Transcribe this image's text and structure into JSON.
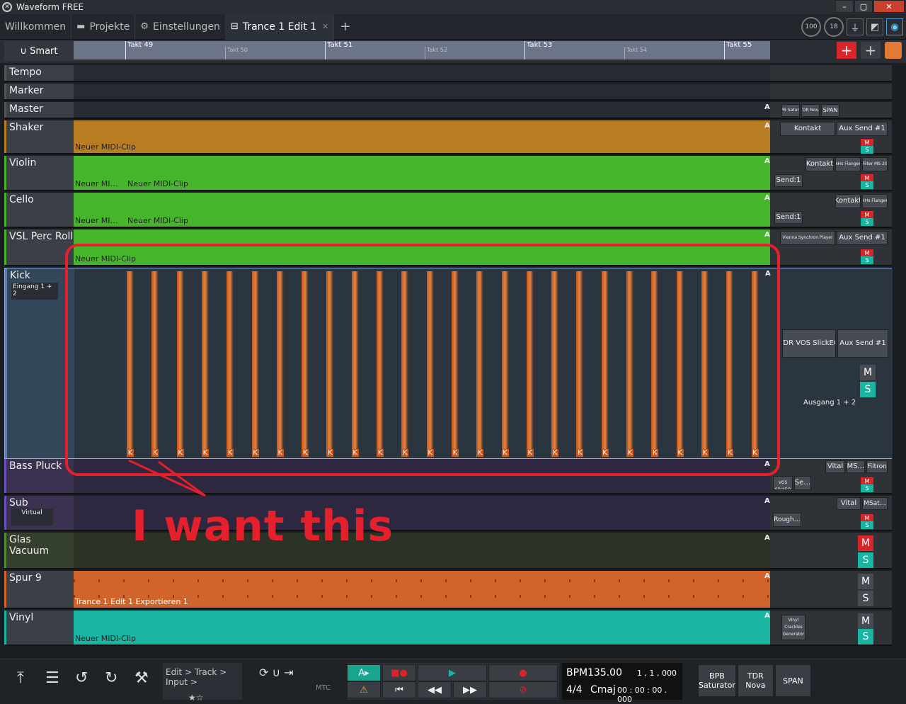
{
  "app": {
    "title": "Waveform FREE"
  },
  "window_buttons": [
    "–",
    "▢",
    "✕"
  ],
  "tabs": [
    {
      "label": "Willkommen",
      "icon": ""
    },
    {
      "label": "Projekte",
      "icon": "folder-icon"
    },
    {
      "label": "Einstellungen",
      "icon": "gear-icon"
    },
    {
      "label": "Trance 1 Edit 1",
      "icon": "edit-icon",
      "active": true
    }
  ],
  "top_right": {
    "cpu": "100",
    "latency": "18"
  },
  "smart": "Smart",
  "ruler": {
    "major": [
      "Takt 49",
      "Takt 51",
      "Takt 53",
      "Takt 55"
    ],
    "minor": [
      "Takt 50",
      "Takt 52",
      "Takt 54"
    ]
  },
  "tracks": [
    {
      "name": "Tempo"
    },
    {
      "name": "Marker"
    },
    {
      "name": "Master",
      "plugins": [
        "BPB Satur…",
        "TDR Nova",
        "SPAN"
      ]
    },
    {
      "name": "Shaker",
      "clip": "Neuer MIDI-Clip",
      "plugins": [
        "Kontakt",
        "Aux Send #1"
      ]
    },
    {
      "name": "Violin",
      "clip": "Neuer MI…",
      "clip2": "Neuer MIDI-Clip",
      "plugins": [
        "Kontakt",
        "kHs Flanger",
        "Filter MS-20"
      ],
      "send": "Send:1"
    },
    {
      "name": "Cello",
      "clip": "Neuer MI…",
      "clip2": "Neuer MIDI-Clip",
      "plugins": [
        "Kontakt",
        "kHs Flanger"
      ],
      "send": "Send:1"
    },
    {
      "name": "VSL Perc Roll",
      "clip": "Neuer MIDI-Clip",
      "plugins": [
        "Vienna Synchron Player",
        "Aux Send #1"
      ]
    },
    {
      "name": "Kick",
      "input": "Eingang 1 + 2",
      "plugins": [
        "TDR VOS SlickEQ",
        "Aux Send #1"
      ],
      "output": "Ausgang 1 + 2",
      "note": "K"
    },
    {
      "name": "Bass Pluck",
      "plugins": [
        "Vital",
        "MS…",
        "Filtron",
        "TDR VOS SlickEQ",
        "Se…"
      ]
    },
    {
      "name": "Sub",
      "input": "Virtual",
      "plugins": [
        "Vital",
        "MSat…",
        "Rough…"
      ]
    },
    {
      "name": "Glas Vacuum"
    },
    {
      "name": "Spur 9",
      "clip": "Trance 1 Edit 1 Exportieren 1"
    },
    {
      "name": "Vinyl",
      "clip": "Neuer MIDI-Clip",
      "plugins": [
        "Vinyl Crackles Generator"
      ]
    }
  ],
  "ms": {
    "m": "M",
    "s": "S"
  },
  "annotation": "I want this",
  "bottom": {
    "breadcrumb": "Edit > Track > Input >",
    "mtc": "MTC",
    "bpm_label": "BPM",
    "bpm": "135.00",
    "position": "1 ,  1 ,  000",
    "signature": "4/4",
    "key": "Cmaj",
    "time": "00 : 00 : 00 . 000",
    "plugins": [
      "BPB Saturator",
      "TDR Nova",
      "SPAN"
    ]
  },
  "colors": {
    "shaker": "#b87d22",
    "green": "#47b52c",
    "kick": "#e07a35",
    "spur9": "#d0642a",
    "vinyl": "#19b5a3",
    "annotation": "#e3202b"
  }
}
